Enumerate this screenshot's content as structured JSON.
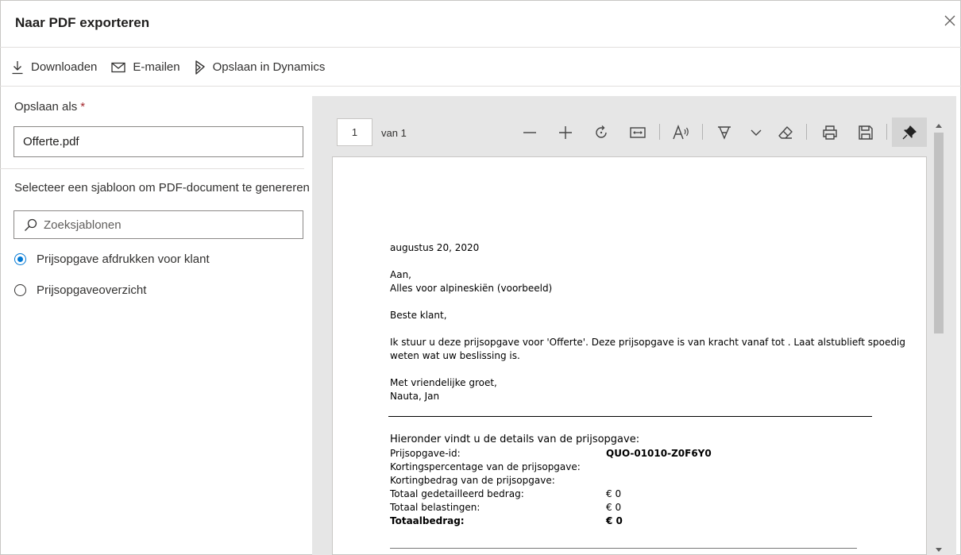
{
  "dialog": {
    "title": "Naar PDF exporteren",
    "close_icon": "close-icon"
  },
  "commandbar": {
    "download_label": "Downloaden",
    "email_label": "E-mailen",
    "save_dynamics_label": "Opslaan in Dynamics"
  },
  "form": {
    "save_as_label": "Opslaan als",
    "required_marker": "*",
    "filename_value": "Offerte.pdf",
    "template_label": "Selecteer een sjabloon om PDF-document te genereren",
    "search_placeholder": "Zoeksjablonen",
    "templates": [
      {
        "label": "Prijsopgave afdrukken voor klant",
        "selected": true
      },
      {
        "label": "Prijsopgaveoverzicht",
        "selected": false
      }
    ]
  },
  "viewer": {
    "page_number": "1",
    "page_of": "van 1"
  },
  "document": {
    "date": "augustus 20, 2020",
    "to_label": "Aan,",
    "recipient": "Alles voor alpineskiën (voorbeeld)",
    "greeting": "Beste klant,",
    "body_line1": "Ik stuur u deze prijsopgave voor 'Offerte'. Deze prijsopgave is van kracht vanaf  tot . Laat alstublieft spoedig",
    "body_line2": "weten wat uw beslissing is.",
    "closing": "Met vriendelijke groet,",
    "sender": "Nauta, Jan",
    "details_heading": "Hieronder vindt u de details van de prijsopgave:",
    "details": [
      {
        "key": "Prijsopgave-id:",
        "value": "QUO-01010-Z0F6Y0"
      },
      {
        "key": "Kortingspercentage van de prijsopgave:",
        "value": ""
      },
      {
        "key": "Kortingbedrag van de prijsopgave:",
        "value": ""
      },
      {
        "key": "Totaal gedetailleerd bedrag:",
        "value": "€ 0"
      },
      {
        "key": "Totaal belastingen:",
        "value": "€ 0"
      },
      {
        "key": "Totaalbedrag:",
        "value": "€ 0"
      }
    ]
  },
  "colors": {
    "accent": "#0078d4",
    "required": "#a4262c",
    "viewer_bg": "#e6e6e6"
  }
}
